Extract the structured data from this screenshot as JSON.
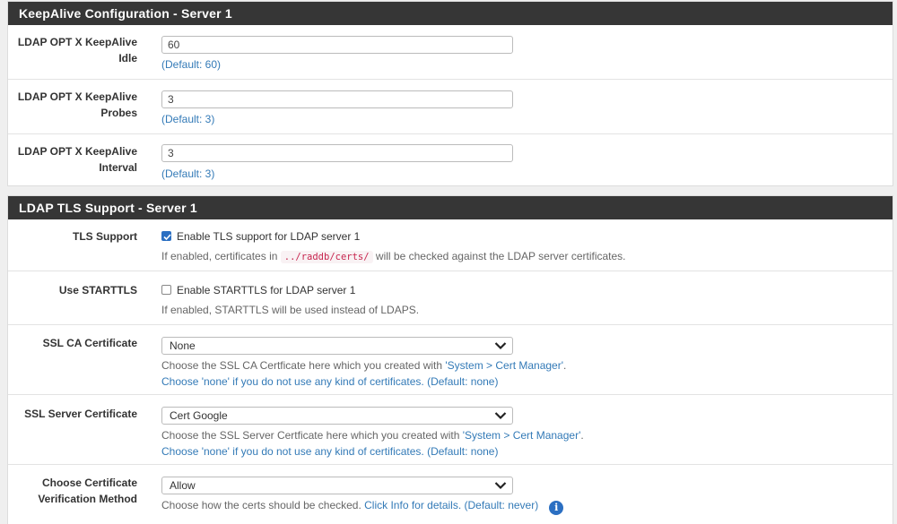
{
  "keepalive": {
    "title": "KeepAlive Configuration - Server 1",
    "idle": {
      "label_line1": "LDAP OPT X KeepAlive",
      "label_line2": "Idle",
      "value": "60",
      "help": "(Default: 60)"
    },
    "probes": {
      "label_line1": "LDAP OPT X KeepAlive",
      "label_line2": "Probes",
      "value": "3",
      "help": "(Default: 3)"
    },
    "interval": {
      "label_line1": "LDAP OPT X KeepAlive",
      "label_line2": "Interval",
      "value": "3",
      "help": "(Default: 3)"
    }
  },
  "tls": {
    "title": "LDAP TLS Support - Server 1",
    "tls_support": {
      "label": "TLS Support",
      "checkbox_label": "Enable TLS support for LDAP server 1",
      "checked": true,
      "help_pre": "If enabled, certificates in",
      "help_code": "../raddb/certs/",
      "help_post": "will be checked against the LDAP server certificates."
    },
    "starttls": {
      "label": "Use STARTTLS",
      "checkbox_label": "Enable STARTTLS for LDAP server 1",
      "checked": false,
      "help": "If enabled, STARTTLS will be used instead of LDAPS."
    },
    "ca_cert": {
      "label": "SSL CA Certificate",
      "selected": "None",
      "help_pre": "Choose the SSL CA Certficate here which you created with ",
      "help_link": "'System > Cert Manager'",
      "help_dot": ".",
      "help_line2": "Choose 'none' if you do not use any kind of certificates. (Default: none)"
    },
    "server_cert": {
      "label": "SSL Server Certificate",
      "selected": "Cert Google",
      "help_pre": "Choose the SSL Server Certficate here which you created with ",
      "help_link": "'System > Cert Manager'",
      "help_dot": ".",
      "help_line2": "Choose 'none' if you do not use any kind of certificates. (Default: none)"
    },
    "verify": {
      "label_line1": "Choose Certificate",
      "label_line2": "Verification Method",
      "selected": "Allow",
      "help_pre": "Choose how the certs should be checked. ",
      "help_link": "Click Info for details. (Default: never)",
      "info_glyph": "i"
    }
  },
  "colors": {
    "heading_bg": "#363636",
    "link": "#337ab7",
    "accent": "#2b6fc2"
  }
}
